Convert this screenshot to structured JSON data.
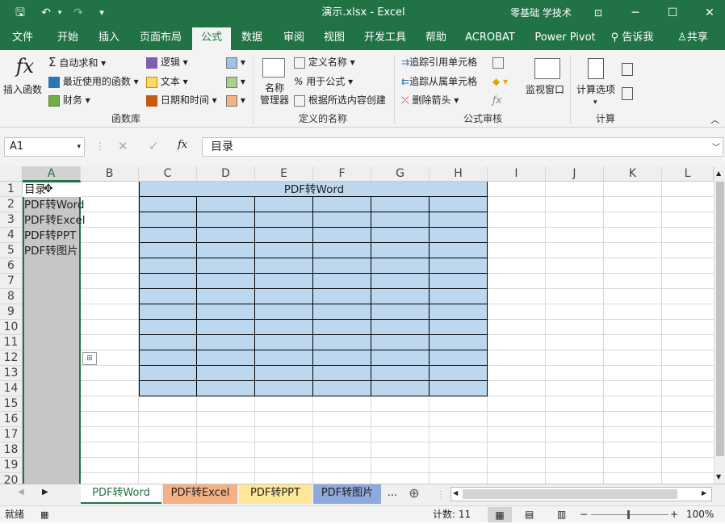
{
  "window": {
    "title": "演示.xlsx  -  Excel",
    "user": "零基础 学技术",
    "ribbon_display_icon": "ribbon-display-icon",
    "minimize": "─",
    "maximize": "☐",
    "close": "✕"
  },
  "quick_access": {
    "save": "🖫",
    "undo": "↶",
    "redo": "↷",
    "customize": "▾"
  },
  "menu_tabs": [
    "文件",
    "开始",
    "插入",
    "页面布局",
    "公式",
    "数据",
    "审阅",
    "视图",
    "开发工具",
    "帮助",
    "ACROBAT",
    "Power Pivot"
  ],
  "active_tab": "公式",
  "tell_me": "告诉我",
  "share": "共享",
  "ribbon": {
    "function_library": {
      "insert_function_icon": "fx",
      "insert_function": "插入函数",
      "autosum": "自动求和",
      "recent": "最近使用的函数",
      "financial": "财务",
      "logical": "逻辑",
      "text": "文本",
      "datetime": "日期和时间",
      "group_label": "函数库"
    },
    "defined_names": {
      "name_manager": "名称\n管理器",
      "define_name": "定义名称",
      "use_in_formula": "用于公式",
      "create_from_selection": "根据所选内容创建",
      "group_label": "定义的名称"
    },
    "formula_auditing": {
      "trace_precedents": "追踪引用单元格",
      "trace_dependents": "追踪从属单元格",
      "remove_arrows": "删除箭头",
      "watch_window": "监视窗口",
      "group_label": "公式审核"
    },
    "calculation": {
      "calc_options": "计算选项",
      "group_label": "计算"
    }
  },
  "formula_bar": {
    "name_box": "A1",
    "cancel": "✕",
    "enter": "✓",
    "fx": "fx",
    "content": "目录"
  },
  "columns": [
    "A",
    "B",
    "C",
    "D",
    "E",
    "F",
    "G",
    "H",
    "I",
    "J",
    "K",
    "L"
  ],
  "rows": [
    "1",
    "2",
    "3",
    "4",
    "5",
    "6",
    "7",
    "8",
    "9",
    "10",
    "11",
    "12",
    "13",
    "14",
    "15",
    "16",
    "17",
    "18",
    "19",
    "20"
  ],
  "cells": {
    "A1": "目录",
    "A2": "PDF转Word",
    "A3": "PDF转Excel",
    "A4": "PDF转PPT",
    "A5": "PDF转图片",
    "C1_merged": "PDF转Word"
  },
  "sheet_tabs": [
    {
      "label": "PDF转Word",
      "color": "#ffffff",
      "active": true
    },
    {
      "label": "PDF转Excel",
      "color": "#f4b183",
      "active": false
    },
    {
      "label": "PDF转PPT",
      "color": "#ffe699",
      "active": false
    },
    {
      "label": "PDF转图片",
      "color": "#8ea9db",
      "active": false
    }
  ],
  "more_sheets": "...",
  "status": {
    "ready": "就绪",
    "count": "计数: 11",
    "zoom": "100%"
  },
  "colors": {
    "excel_green": "#217346",
    "selected_col": "#c6c6c6",
    "table_fill": "#bdd7ee"
  }
}
